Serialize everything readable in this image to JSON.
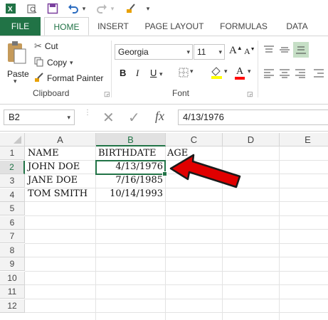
{
  "qat": {
    "icons": [
      "excel-icon",
      "open-icon",
      "save-icon",
      "undo-icon",
      "redo-icon",
      "brush-icon",
      "more-icon"
    ]
  },
  "tabs": [
    {
      "label": "FILE"
    },
    {
      "label": "HOME"
    },
    {
      "label": "INSERT"
    },
    {
      "label": "PAGE LAYOUT"
    },
    {
      "label": "FORMULAS"
    },
    {
      "label": "DATA"
    }
  ],
  "ribbon": {
    "paste_label": "Paste",
    "cut_label": "Cut",
    "copy_label": "Copy",
    "format_painter_label": "Format Painter",
    "clipboard_group": "Clipboard",
    "font_name": "Georgia",
    "font_size": "11",
    "font_group": "Font",
    "bold": "B",
    "italic": "I",
    "underline": "U",
    "grow_font": "A",
    "shrink_font": "A",
    "font_color_accent": "#ff0000",
    "fill_color_accent": "#ffff00"
  },
  "formula_bar": {
    "name_box": "B2",
    "fx_label": "fx",
    "value": "4/13/1976"
  },
  "columns": [
    "A",
    "B",
    "C",
    "D",
    "E"
  ],
  "rows": [
    "1",
    "2",
    "3",
    "4",
    "5",
    "6",
    "7",
    "8",
    "9",
    "10",
    "11",
    "12"
  ],
  "cells": {
    "A1": "NAME",
    "B1": "BIRTHDATE",
    "C1": "AGE",
    "A2": "JOHN DOE",
    "B2": "4/13/1976",
    "A3": "JANE DOE",
    "B3": "7/16/1985",
    "A4": "TOM SMITH",
    "B4": "10/14/1993"
  },
  "selected_cell": "B2",
  "accent_color": "#217346",
  "arrow_color": "#e00000"
}
